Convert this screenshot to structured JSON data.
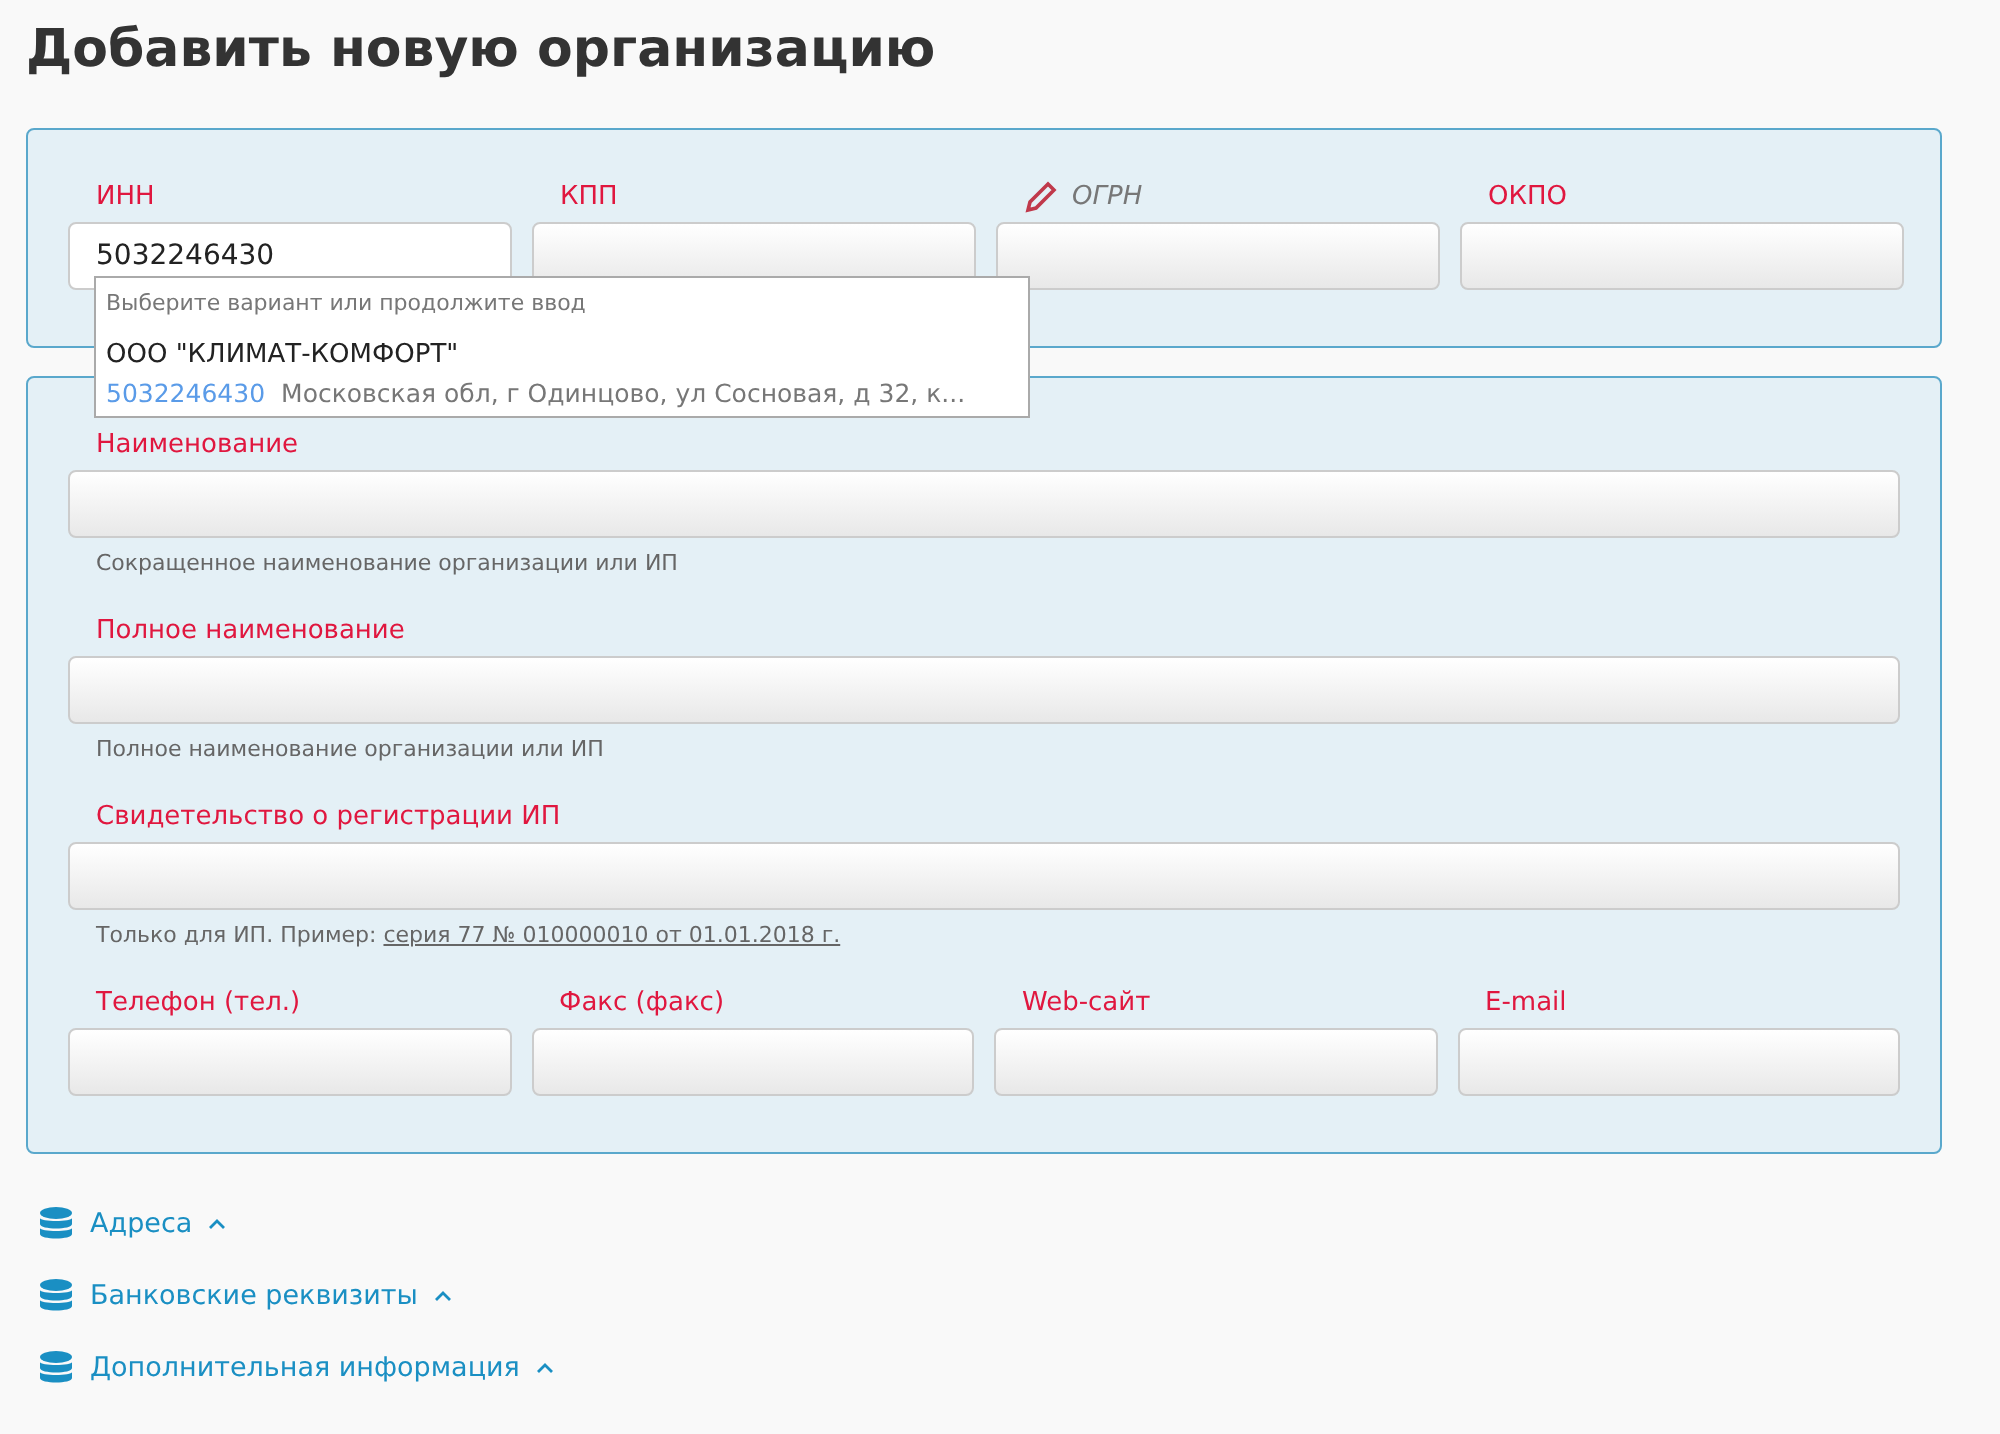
{
  "title": "Добавить новую организацию",
  "codes": [
    {
      "label": "ИНН",
      "required": true,
      "value": "5032246430",
      "focused": true
    },
    {
      "label": "КПП",
      "required": true,
      "focused": false
    },
    {
      "label": "ОГРН",
      "required": false,
      "focused": false
    },
    {
      "label": "ОКПО",
      "required": true,
      "focused": false
    }
  ],
  "suggestions": {
    "hint": "Выберите вариант или продолжите ввод",
    "items": [
      {
        "name": "ООО \"КЛИМАТ-КОМФОРТ\"",
        "inn": "5032246430",
        "address": "Московская обл, г Одинцово, ул Сосновая, д 32, к..."
      }
    ]
  },
  "details": [
    {
      "label": "Наименование",
      "help": "Сокращенное наименование организации или ИП"
    },
    {
      "label": "Полное наименование",
      "help": "Полное наименование организации или ИП"
    },
    {
      "label": "Свидетельство о регистрации ИП",
      "help": "Только для ИП. Пример:",
      "example": "серия 77 № 010000010 от 01.01.2018 г."
    }
  ],
  "contacts": [
    {
      "label": "Телефон (тел.)"
    },
    {
      "label": "Факс (факс)"
    },
    {
      "label": "Web-сайт"
    },
    {
      "label": "E-mail"
    }
  ],
  "sections": [
    {
      "label": "Адреса",
      "expanded": false
    },
    {
      "label": "Банковские реквизиты",
      "expanded": false
    },
    {
      "label": "Дополнительная информация",
      "expanded": false
    }
  ]
}
